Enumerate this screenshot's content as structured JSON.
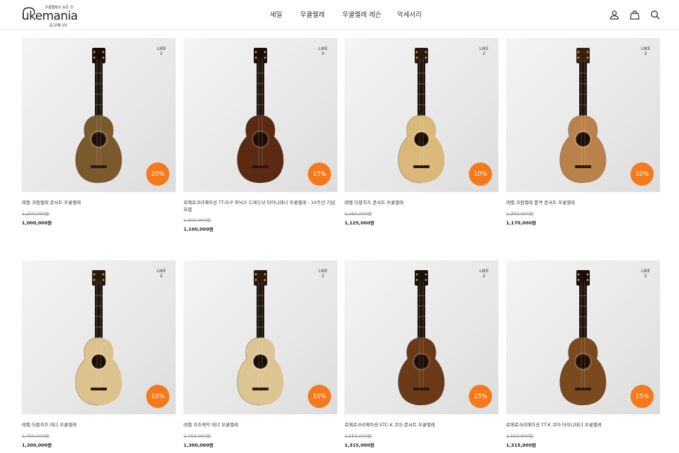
{
  "header": {
    "logo_word": "ukemania",
    "logo_tagline": "우쿨렐레의 모든 것",
    "logo_sub": "유크매니아",
    "nav": [
      "세일",
      "우쿨렐레",
      "우쿨렐레 레슨",
      "악세서리"
    ],
    "icons": [
      "user-icon",
      "shopping-bag-icon",
      "search-icon"
    ]
  },
  "like_label": "LIKE",
  "products": [
    {
      "name": "레벨 크림렐레 콘서트 우쿨렐레",
      "like": "2",
      "discount": "20%",
      "original_price": "1,250,000원",
      "sale_price": "1,000,000원",
      "body_color": "#7a5a2c",
      "top_tone": "dark"
    },
    {
      "name": "로에로크리에이션 TT-D-P 피닉스 드레드넛 타이니테너 우쿨렐레 - 10주년 기념 모델",
      "like": "0",
      "discount": "15%",
      "original_price": "1,300,000원",
      "sale_price": "1,100,000원",
      "body_color": "#5a2a12",
      "top_tone": "dark"
    },
    {
      "name": "레벨 더블치즈 콘서트 우쿨렐레",
      "like": "2",
      "discount": "10%",
      "original_price": "1,250,000원",
      "sale_price": "1,125,000원",
      "body_color": "#d9b87a",
      "top_tone": "light"
    },
    {
      "name": "레벨 크림렐레 품격 콘서트 우쿨렐레",
      "like": "2",
      "discount": "10%",
      "original_price": "1,300,000원",
      "sale_price": "1,170,000원",
      "body_color": "#b9824a",
      "top_tone": "mid"
    },
    {
      "name": "레벨 더블치즈 테너 우쿨렐레",
      "like": "2",
      "discount": "10%",
      "original_price": "1,450,000원",
      "sale_price": "1,300,000원",
      "body_color": "#dcc28c",
      "top_tone": "light"
    },
    {
      "name": "레벨 치즈케익 테너 우쿨렐레",
      "like": "2",
      "discount": "10%",
      "original_price": "1,450,000원",
      "sale_price": "1,300,000원",
      "body_color": "#dcc593",
      "top_tone": "light"
    },
    {
      "name": "로에로크리에이션 STC-K 코아 콘서트 우쿨렐레",
      "like": "2",
      "discount": "15%",
      "original_price": "1,550,000원",
      "sale_price": "1,315,000원",
      "body_color": "#6a3a18",
      "top_tone": "dark"
    },
    {
      "name": "로에로크리에이션 TT-K 코아 타이니테너 우쿨렐레",
      "like": "2",
      "discount": "15%",
      "original_price": "1,550,000원",
      "sale_price": "1,315,000원",
      "body_color": "#7a4a1e",
      "top_tone": "dark"
    }
  ]
}
